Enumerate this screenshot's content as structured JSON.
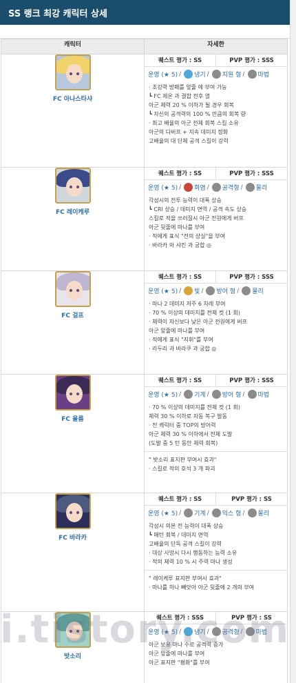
{
  "title": "SS 랭크 최강 캐릭터 상세",
  "columns": {
    "character": "캐릭터",
    "detail": "자세한"
  },
  "characters": [
    {
      "name": "FC 아나스타샤",
      "quest_rating": "퀘스트 평가 : SS",
      "pvp_rating": "PVP 평가 : SSS",
      "tags": [
        "운영 (★ 5)",
        "냉기",
        "지원 형",
        "마법"
      ],
      "lines": [
        "· 초강력 방패를 앞줄 에 부여 가능",
        " ┗ FC 제온 과 결합 전후 열",
        "아군 체력 20 % 이하가 될 경우 회복",
        " ┗ 자신의 공격력의 100 % 만큼의 회복 량",
        "· 최고 배율의 아군 전체 회복 스킬 소유",
        "아군의 디버프 + 지속 데미지 정화",
        "고배율의 대 단체 공격 스킬이 강력"
      ],
      "extra": []
    },
    {
      "name": "FC 레이케루",
      "quest_rating": "퀘스트 평가 : SS",
      "pvp_rating": "PVP 평가 : SSS",
      "tags": [
        "운영 (★ 5)",
        "화염",
        "공격형",
        "물리"
      ],
      "lines": [
        "각성시의 전투 능력이 대폭 상승",
        " ┗ CRI 상승 / 데미지 면역 / 공격 속도 상승",
        "스킬로 적을 쓰러질시 아군 전원에게 버프",
        "아군 뒷줄에 마나를 부여",
        "· 적에게 표식 \"전의 상실\"을 부여",
        "· 바라카 와 샤킨 과 궁합 ◎"
      ],
      "extra": []
    },
    {
      "name": "FC 걸프",
      "quest_rating": "퀘스트 평가 : SS",
      "pvp_rating": "PVP 평가 : SSS",
      "tags": [
        "운영 (★ 5)",
        "빛",
        "방어 형",
        "물리"
      ],
      "lines": [
        "· 마나 2 데미지 저주 6 차례 부여",
        "· 70 % 이상의 데미지를 전체 컷 (1 회)",
        "· 체력이 자신보다 낮은 아군 전원에게 버프",
        "아군 앞줄에 마나를 부여",
        "· 적에게 표식 \"지휘\"를 부여",
        "· 라두리 과 바라쿠 과 궁합 ◎"
      ],
      "extra": []
    },
    {
      "name": "FC 울름",
      "quest_rating": "퀘스트 평가 : SS",
      "pvp_rating": "PVP 평가 : SSS",
      "tags": [
        "운영 (★ 5)",
        "기계",
        "방어 형",
        "마법"
      ],
      "lines": [
        "· 70 % 이상의 데미지를 전체 컷 (1 회)",
        "체력 30 % 이하로 자동 복구 발동",
        "· 전 캐릭터 중 TOP의 방어력",
        "아군 체력 30 % 이하에서 전체 도발",
        "  (도발 중 5 턴 동안 체력 회복)"
      ],
      "extra": [
        "\" 밧소리 표지판 부여시 효과\"",
        "· 스킬로 적의 호석 3 개 파괴"
      ]
    },
    {
      "name": "FC 바라카",
      "quest_rating": "퀘스트 평가 : SS",
      "pvp_rating": "PVP 평가 : SS",
      "tags": [
        "운영 (★ 5)",
        "기계",
        "믹스 형",
        "물리"
      ],
      "lines": [
        "각성시 의본 전 능력이 대폭 상승",
        " ┗ 매턴 회복 / 데미지 면역",
        "고배율의 단독 공격 스킬이 강력",
        "· 대상 사망시 다시 행동하는 능력 소유",
        "· 적의 체력 10 % 시 주력 마나 생성"
      ],
      "extra": [
        "\" 레이케루 표지판 부여시 효과\"",
        "· 마나를 하나 빼앗아 아군 뒷줄에 2 개의 부여"
      ]
    },
    {
      "name": "밧소리",
      "quest_rating": "퀘스트 평가 : SSS",
      "pvp_rating": "PVP 평가 : SS",
      "tags": [
        "운영 (★ 5)",
        "냉기",
        "공격형",
        "마법"
      ],
      "lines": [
        "아군 보유 마나 수로 공격력 증가",
        "아군 앞줄에 마나를 부여",
        "아군 표지판 \"평화\"를 부여"
      ],
      "extra": []
    }
  ],
  "icons": {
    "element": [
      "snowflake-icon",
      "fire-icon",
      "sun-icon",
      "gear-icon"
    ],
    "role": [
      "cross-icon",
      "sword-icon",
      "shield-icon",
      "mix-icon"
    ],
    "type": [
      "hex-icon"
    ]
  },
  "watermark": "i.tistory.com/"
}
